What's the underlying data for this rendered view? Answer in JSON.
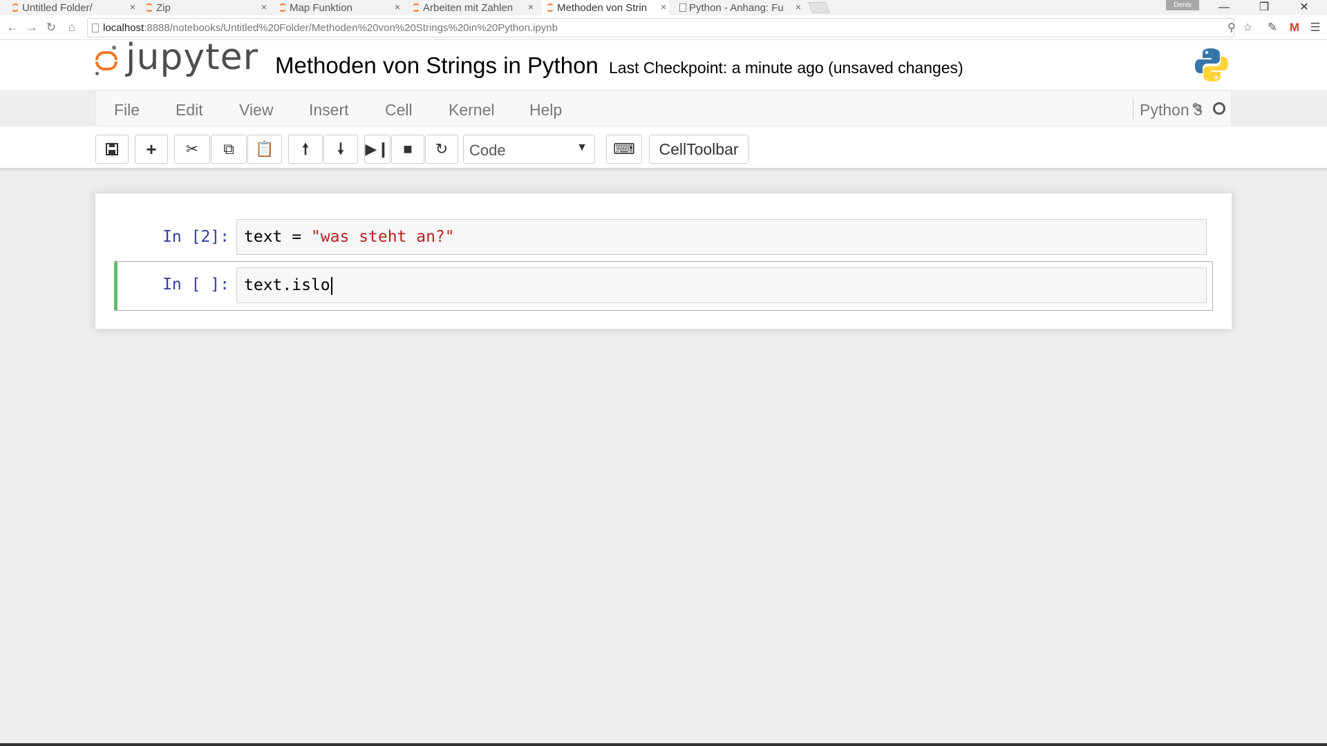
{
  "browser": {
    "tabs": [
      {
        "label": "Untitled Folder/",
        "icon": "jupyter-icon"
      },
      {
        "label": "Zip",
        "icon": "jupyter-icon"
      },
      {
        "label": "Map Funktion",
        "icon": "jupyter-icon"
      },
      {
        "label": "Arbeiten mit Zahlen",
        "icon": "jupyter-icon"
      },
      {
        "label": "Methoden von Strin",
        "icon": "jupyter-icon",
        "active": true
      },
      {
        "label": "Python - Anhang: Fu",
        "icon": "document-icon"
      }
    ],
    "close_glyph": "×",
    "user_badge": "Denis",
    "window_controls": {
      "minimize": "—",
      "restore": "❐",
      "close": "✕"
    },
    "url_host": "localhost",
    "url_path": ":8888/notebooks/Untitled%20Folder/Methoden%20von%20Strings%20in%20Python.ipynb"
  },
  "header": {
    "logo_text": "jupyter",
    "notebook_title": "Methoden von Strings in Python",
    "checkpoint": "Last Checkpoint: a minute ago (unsaved changes)"
  },
  "menu": {
    "items": [
      "File",
      "Edit",
      "View",
      "Insert",
      "Cell",
      "Kernel",
      "Help"
    ],
    "kernel_name": "Python 3"
  },
  "toolbar": {
    "cell_type": "Code",
    "celltoolbar_label": "CellToolbar"
  },
  "cells": [
    {
      "prompt": "In [2]:",
      "code_prefix": "text = ",
      "code_string": "\"was steht an?\""
    },
    {
      "prompt": "In [ ]:",
      "code": "text.islo",
      "selected": true
    }
  ],
  "colors": {
    "jupyter_orange": "#f37726",
    "selected_cell_border": "#66bb6a",
    "prompt_blue": "#303f9f",
    "string_red": "#ba2121"
  }
}
